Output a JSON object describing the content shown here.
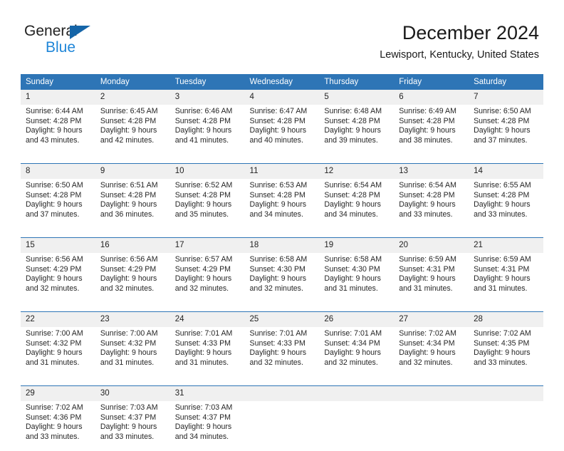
{
  "logo": {
    "word_top": "General",
    "word_bottom": "Blue",
    "triangle_color": "#1565a8",
    "blue_color": "#1f86d8"
  },
  "header": {
    "title": "December 2024",
    "subtitle": "Lewisport, Kentucky, United States"
  },
  "theme": {
    "header_blue": "#2e75b6",
    "daynum_band": "#f0f0f0",
    "text": "#262626"
  },
  "weekday_headers": [
    "Sunday",
    "Monday",
    "Tuesday",
    "Wednesday",
    "Thursday",
    "Friday",
    "Saturday"
  ],
  "weeks": [
    {
      "days": [
        {
          "num": "1",
          "sunrise": "Sunrise: 6:44 AM",
          "sunset": "Sunset: 4:28 PM",
          "daylight1": "Daylight: 9 hours",
          "daylight2": "and 43 minutes."
        },
        {
          "num": "2",
          "sunrise": "Sunrise: 6:45 AM",
          "sunset": "Sunset: 4:28 PM",
          "daylight1": "Daylight: 9 hours",
          "daylight2": "and 42 minutes."
        },
        {
          "num": "3",
          "sunrise": "Sunrise: 6:46 AM",
          "sunset": "Sunset: 4:28 PM",
          "daylight1": "Daylight: 9 hours",
          "daylight2": "and 41 minutes."
        },
        {
          "num": "4",
          "sunrise": "Sunrise: 6:47 AM",
          "sunset": "Sunset: 4:28 PM",
          "daylight1": "Daylight: 9 hours",
          "daylight2": "and 40 minutes."
        },
        {
          "num": "5",
          "sunrise": "Sunrise: 6:48 AM",
          "sunset": "Sunset: 4:28 PM",
          "daylight1": "Daylight: 9 hours",
          "daylight2": "and 39 minutes."
        },
        {
          "num": "6",
          "sunrise": "Sunrise: 6:49 AM",
          "sunset": "Sunset: 4:28 PM",
          "daylight1": "Daylight: 9 hours",
          "daylight2": "and 38 minutes."
        },
        {
          "num": "7",
          "sunrise": "Sunrise: 6:50 AM",
          "sunset": "Sunset: 4:28 PM",
          "daylight1": "Daylight: 9 hours",
          "daylight2": "and 37 minutes."
        }
      ]
    },
    {
      "days": [
        {
          "num": "8",
          "sunrise": "Sunrise: 6:50 AM",
          "sunset": "Sunset: 4:28 PM",
          "daylight1": "Daylight: 9 hours",
          "daylight2": "and 37 minutes."
        },
        {
          "num": "9",
          "sunrise": "Sunrise: 6:51 AM",
          "sunset": "Sunset: 4:28 PM",
          "daylight1": "Daylight: 9 hours",
          "daylight2": "and 36 minutes."
        },
        {
          "num": "10",
          "sunrise": "Sunrise: 6:52 AM",
          "sunset": "Sunset: 4:28 PM",
          "daylight1": "Daylight: 9 hours",
          "daylight2": "and 35 minutes."
        },
        {
          "num": "11",
          "sunrise": "Sunrise: 6:53 AM",
          "sunset": "Sunset: 4:28 PM",
          "daylight1": "Daylight: 9 hours",
          "daylight2": "and 34 minutes."
        },
        {
          "num": "12",
          "sunrise": "Sunrise: 6:54 AM",
          "sunset": "Sunset: 4:28 PM",
          "daylight1": "Daylight: 9 hours",
          "daylight2": "and 34 minutes."
        },
        {
          "num": "13",
          "sunrise": "Sunrise: 6:54 AM",
          "sunset": "Sunset: 4:28 PM",
          "daylight1": "Daylight: 9 hours",
          "daylight2": "and 33 minutes."
        },
        {
          "num": "14",
          "sunrise": "Sunrise: 6:55 AM",
          "sunset": "Sunset: 4:28 PM",
          "daylight1": "Daylight: 9 hours",
          "daylight2": "and 33 minutes."
        }
      ]
    },
    {
      "days": [
        {
          "num": "15",
          "sunrise": "Sunrise: 6:56 AM",
          "sunset": "Sunset: 4:29 PM",
          "daylight1": "Daylight: 9 hours",
          "daylight2": "and 32 minutes."
        },
        {
          "num": "16",
          "sunrise": "Sunrise: 6:56 AM",
          "sunset": "Sunset: 4:29 PM",
          "daylight1": "Daylight: 9 hours",
          "daylight2": "and 32 minutes."
        },
        {
          "num": "17",
          "sunrise": "Sunrise: 6:57 AM",
          "sunset": "Sunset: 4:29 PM",
          "daylight1": "Daylight: 9 hours",
          "daylight2": "and 32 minutes."
        },
        {
          "num": "18",
          "sunrise": "Sunrise: 6:58 AM",
          "sunset": "Sunset: 4:30 PM",
          "daylight1": "Daylight: 9 hours",
          "daylight2": "and 32 minutes."
        },
        {
          "num": "19",
          "sunrise": "Sunrise: 6:58 AM",
          "sunset": "Sunset: 4:30 PM",
          "daylight1": "Daylight: 9 hours",
          "daylight2": "and 31 minutes."
        },
        {
          "num": "20",
          "sunrise": "Sunrise: 6:59 AM",
          "sunset": "Sunset: 4:31 PM",
          "daylight1": "Daylight: 9 hours",
          "daylight2": "and 31 minutes."
        },
        {
          "num": "21",
          "sunrise": "Sunrise: 6:59 AM",
          "sunset": "Sunset: 4:31 PM",
          "daylight1": "Daylight: 9 hours",
          "daylight2": "and 31 minutes."
        }
      ]
    },
    {
      "days": [
        {
          "num": "22",
          "sunrise": "Sunrise: 7:00 AM",
          "sunset": "Sunset: 4:32 PM",
          "daylight1": "Daylight: 9 hours",
          "daylight2": "and 31 minutes."
        },
        {
          "num": "23",
          "sunrise": "Sunrise: 7:00 AM",
          "sunset": "Sunset: 4:32 PM",
          "daylight1": "Daylight: 9 hours",
          "daylight2": "and 31 minutes."
        },
        {
          "num": "24",
          "sunrise": "Sunrise: 7:01 AM",
          "sunset": "Sunset: 4:33 PM",
          "daylight1": "Daylight: 9 hours",
          "daylight2": "and 31 minutes."
        },
        {
          "num": "25",
          "sunrise": "Sunrise: 7:01 AM",
          "sunset": "Sunset: 4:33 PM",
          "daylight1": "Daylight: 9 hours",
          "daylight2": "and 32 minutes."
        },
        {
          "num": "26",
          "sunrise": "Sunrise: 7:01 AM",
          "sunset": "Sunset: 4:34 PM",
          "daylight1": "Daylight: 9 hours",
          "daylight2": "and 32 minutes."
        },
        {
          "num": "27",
          "sunrise": "Sunrise: 7:02 AM",
          "sunset": "Sunset: 4:34 PM",
          "daylight1": "Daylight: 9 hours",
          "daylight2": "and 32 minutes."
        },
        {
          "num": "28",
          "sunrise": "Sunrise: 7:02 AM",
          "sunset": "Sunset: 4:35 PM",
          "daylight1": "Daylight: 9 hours",
          "daylight2": "and 33 minutes."
        }
      ]
    },
    {
      "days": [
        {
          "num": "29",
          "sunrise": "Sunrise: 7:02 AM",
          "sunset": "Sunset: 4:36 PM",
          "daylight1": "Daylight: 9 hours",
          "daylight2": "and 33 minutes."
        },
        {
          "num": "30",
          "sunrise": "Sunrise: 7:03 AM",
          "sunset": "Sunset: 4:37 PM",
          "daylight1": "Daylight: 9 hours",
          "daylight2": "and 33 minutes."
        },
        {
          "num": "31",
          "sunrise": "Sunrise: 7:03 AM",
          "sunset": "Sunset: 4:37 PM",
          "daylight1": "Daylight: 9 hours",
          "daylight2": "and 34 minutes."
        },
        {
          "num": "",
          "sunrise": "",
          "sunset": "",
          "daylight1": "",
          "daylight2": ""
        },
        {
          "num": "",
          "sunrise": "",
          "sunset": "",
          "daylight1": "",
          "daylight2": ""
        },
        {
          "num": "",
          "sunrise": "",
          "sunset": "",
          "daylight1": "",
          "daylight2": ""
        },
        {
          "num": "",
          "sunrise": "",
          "sunset": "",
          "daylight1": "",
          "daylight2": ""
        }
      ]
    }
  ]
}
